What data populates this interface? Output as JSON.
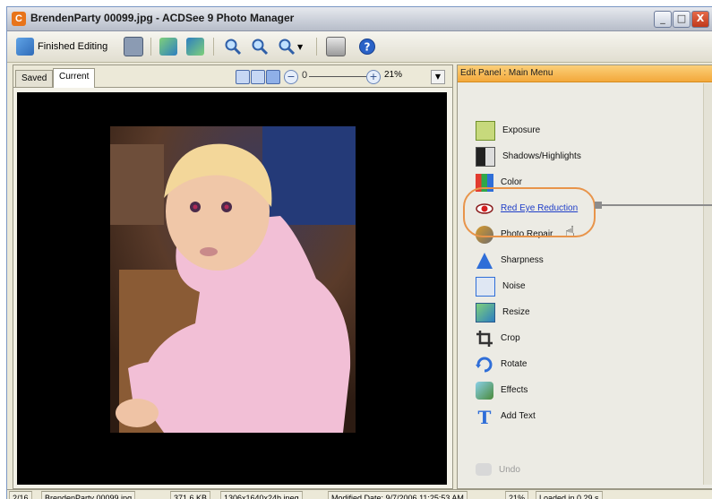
{
  "window": {
    "title": "BrendenParty 00099.jpg - ACDSee 9 Photo Manager",
    "app_icon_letter": "C",
    "minimize_glyph": "_",
    "maximize_glyph": "□",
    "close_glyph": "X"
  },
  "toolbar": {
    "finished_editing_label": "Finished Editing",
    "icons": [
      "finished-editing-icon",
      "save-icon",
      "previous-image-icon",
      "next-image-icon",
      "zoom-in-icon",
      "zoom-out-icon",
      "zoom-menu-icon",
      "print-icon",
      "help-icon"
    ]
  },
  "document": {
    "tabs": [
      {
        "label": "Saved"
      },
      {
        "label": "Current"
      }
    ],
    "active_tab": "Current",
    "zoom": {
      "minus_glyph": "−",
      "plus_glyph": "+",
      "knob_glyph": "0",
      "value": "21%"
    }
  },
  "edit_panel": {
    "header": "Edit Panel : Main Menu",
    "items": [
      {
        "label": "Exposure",
        "icon": "exposure-icon"
      },
      {
        "label": "Shadows/Highlights",
        "icon": "shadows-highlights-icon"
      },
      {
        "label": "Color",
        "icon": "color-icon"
      },
      {
        "label": "Red Eye Reduction",
        "icon": "red-eye-icon",
        "highlighted": true
      },
      {
        "label": "Photo Repair",
        "icon": "photo-repair-icon"
      },
      {
        "label": "Sharpness",
        "icon": "sharpness-icon"
      },
      {
        "label": "Noise",
        "icon": "noise-icon"
      },
      {
        "label": "Resize",
        "icon": "resize-icon"
      },
      {
        "label": "Crop",
        "icon": "crop-icon"
      },
      {
        "label": "Rotate",
        "icon": "rotate-icon"
      },
      {
        "label": "Effects",
        "icon": "effects-icon"
      },
      {
        "label": "Add Text",
        "icon": "add-text-icon"
      }
    ],
    "undo_label": "Undo"
  },
  "status": {
    "position": "2/16",
    "filename": "BrendenParty 00099.jpg",
    "filesize": "371.6 KB",
    "dimensions": "1306x1640x24b jpeg",
    "modified": "Modified Date: 9/7/2006 11:25:53 AM",
    "zoom": "21%",
    "load_time": "Loaded in 0.29 s"
  },
  "colors": {
    "accent_orange": "#f3a83b",
    "highlight_ring": "#e8944a",
    "link_blue": "#1f3ec8",
    "titlebar": "#c9ced8"
  }
}
